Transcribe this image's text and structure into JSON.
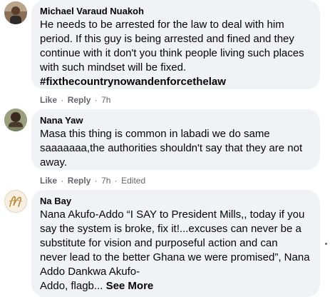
{
  "comments": [
    {
      "author": "Michael Varaud Nuakoh",
      "lines": [
        "He needs to be arrested for the law to deal with him",
        "period. If this guy is being arrested and fined and they",
        "continue with it don't you think people living such places",
        "with such mindset will be fixed."
      ],
      "hashtag": "#fixthecountrynowandenforcethelaw",
      "like": "Like",
      "reply": "Reply",
      "time": "7h",
      "edited": ""
    },
    {
      "author": "Nana Yaw",
      "lines": [
        "Masa this thing is common in labadi we do same",
        "saaaaaaa,the authorities shouldn't say that they are not",
        "away."
      ],
      "like": "Like",
      "reply": "Reply",
      "time": "7h",
      "edited": "Edited"
    },
    {
      "author": "Na Bay",
      "lines": [
        "Nana Akufo-Addo “I SAY to President Mills,, today if you",
        "say the system is broke, fix it!...excuses can never be a",
        "substitute for vision and purposeful action and can",
        "never lead to the better Ghana we were promised”, Nana",
        "Addo Dankwa Akufo-"
      ],
      "last_line": "Addo, flagb...",
      "see_more": "See More"
    }
  ],
  "separator": "·"
}
